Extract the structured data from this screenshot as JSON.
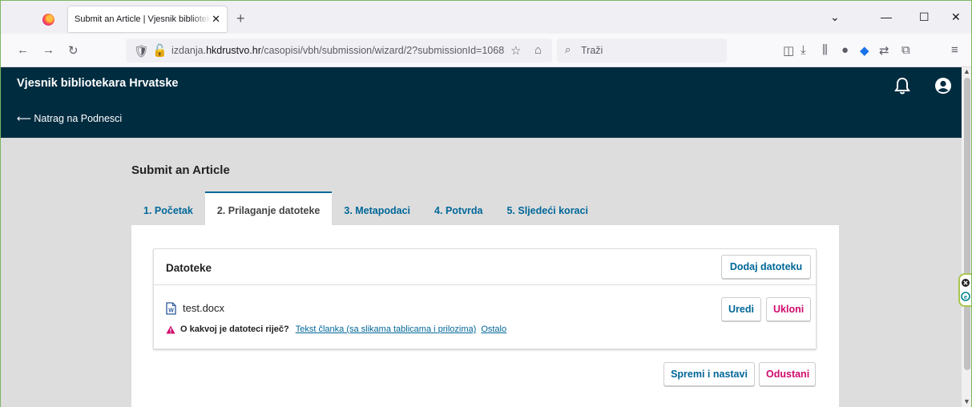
{
  "browser": {
    "tab_title": "Submit an Article | Vjesnik bibliotekara Hrvatske",
    "tab_close": "✕",
    "new_tab": "+",
    "url_prefix": "izdanja.",
    "url_host": "hkdrustvo.hr",
    "url_path": "/casopisi/vbh/submission/wizard/2?submissionId=1068",
    "search_placeholder": "Traži"
  },
  "app": {
    "site_title": "Vjesnik bibliotekara Hrvatske",
    "back_link": "⟵ Natrag na Podnesci"
  },
  "page": {
    "title": "Submit an Article",
    "tabs": [
      {
        "label": "1. Početak"
      },
      {
        "label": "2. Prilaganje datoteke"
      },
      {
        "label": "3. Metapodaci"
      },
      {
        "label": "4. Potvrda"
      },
      {
        "label": "5. Sljedeći koraci"
      }
    ],
    "active_tab": 1
  },
  "files": {
    "title": "Datoteke",
    "add_button": "Dodaj datoteku",
    "items": [
      {
        "name": "test.docx",
        "genre_question": "O kakvoj je datoteci riječ?",
        "genre_options": [
          "Tekst članka (sa slikama tablicama i prilozima)",
          "Ostalo"
        ],
        "edit_button": "Uredi",
        "remove_button": "Ukloni"
      }
    ]
  },
  "actions": {
    "save_continue": "Spremi i nastavi",
    "cancel": "Odustani"
  },
  "colors": {
    "header_bg": "#002c40",
    "link": "#006798",
    "danger": "#d00a6c",
    "warning": "#d00a6c"
  }
}
